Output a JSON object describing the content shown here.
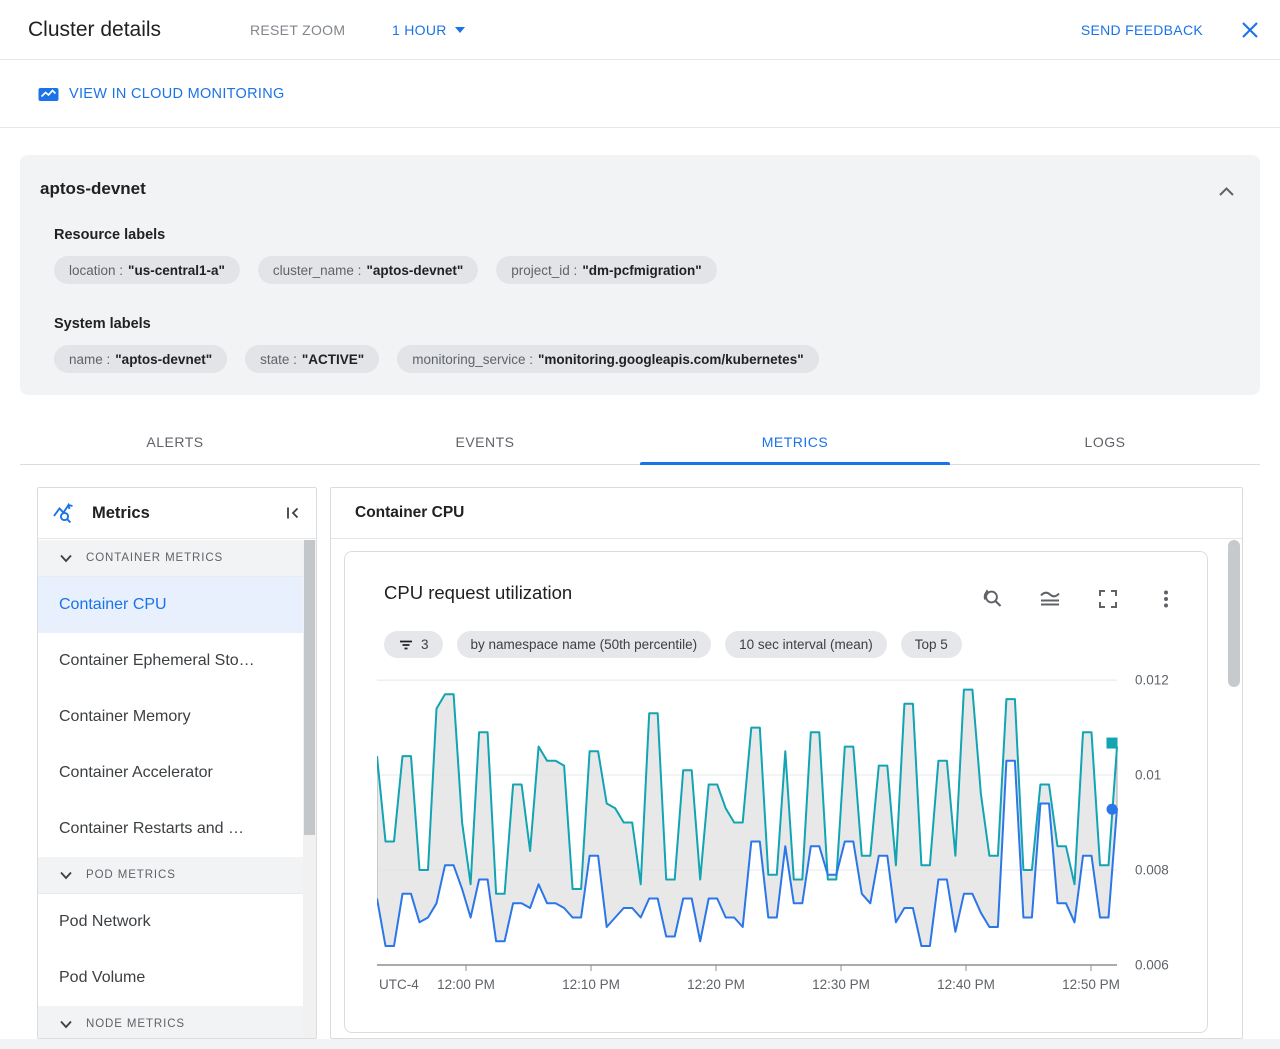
{
  "header": {
    "title": "Cluster details",
    "reset_zoom": "RESET ZOOM",
    "time_range": "1 HOUR",
    "send_feedback": "SEND FEEDBACK"
  },
  "toolbar": {
    "view_in_monitoring": "VIEW IN CLOUD MONITORING"
  },
  "cluster_info": {
    "name": "aptos-devnet",
    "resource_labels_title": "Resource labels",
    "resource_labels": [
      {
        "key": "location",
        "value": "\"us-central1-a\""
      },
      {
        "key": "cluster_name",
        "value": "\"aptos-devnet\""
      },
      {
        "key": "project_id",
        "value": "\"dm-pcfmigration\""
      }
    ],
    "system_labels_title": "System labels",
    "system_labels": [
      {
        "key": "name",
        "value": "\"aptos-devnet\""
      },
      {
        "key": "state",
        "value": "\"ACTIVE\""
      },
      {
        "key": "monitoring_service",
        "value": "\"monitoring.googleapis.com/kubernetes\""
      }
    ]
  },
  "tabs": [
    {
      "label": "ALERTS",
      "active": false
    },
    {
      "label": "EVENTS",
      "active": false
    },
    {
      "label": "METRICS",
      "active": true
    },
    {
      "label": "LOGS",
      "active": false
    }
  ],
  "sidebar": {
    "title": "Metrics",
    "sections": [
      {
        "header": "CONTAINER METRICS",
        "items": [
          {
            "label": "Container CPU",
            "selected": true
          },
          {
            "label": "Container Ephemeral Sto…",
            "selected": false
          },
          {
            "label": "Container Memory",
            "selected": false
          },
          {
            "label": "Container Accelerator",
            "selected": false
          },
          {
            "label": "Container Restarts and …",
            "selected": false
          }
        ]
      },
      {
        "header": "POD METRICS",
        "items": [
          {
            "label": "Pod Network",
            "selected": false
          },
          {
            "label": "Pod Volume",
            "selected": false
          }
        ]
      },
      {
        "header": "NODE METRICS",
        "items": []
      }
    ]
  },
  "main": {
    "panel_title": "Container CPU",
    "card": {
      "title": "CPU request utilization",
      "filter_chip_count": "3",
      "chips": [
        "by namespace name (50th percentile)",
        "10 sec interval (mean)",
        "Top 5"
      ]
    }
  },
  "chart_data": {
    "type": "line",
    "title": "CPU request utilization",
    "x_axis_label": "UTC-4",
    "x_tick_labels": [
      "12:00 PM",
      "12:10 PM",
      "12:20 PM",
      "12:30 PM",
      "12:40 PM",
      "12:50 PM"
    ],
    "y_ticks": [
      0.006,
      0.008,
      0.01,
      0.012
    ],
    "y_tick_labels": [
      "0.006",
      "0.008",
      "0.01",
      "0.012"
    ],
    "ylim": [
      0.006,
      0.01217
    ],
    "grid": "horizontal",
    "legend": "none",
    "band": {
      "between": [
        "max",
        "min"
      ],
      "fill": "#e4e4e4",
      "edge": "#aaaaaa"
    },
    "series": [
      {
        "name": "max",
        "color": "#12a4b2",
        "marker": "square",
        "values": [
          0.0104,
          0.0086,
          0.0086,
          0.0104,
          0.0104,
          0.008,
          0.008,
          0.0114,
          0.0117,
          0.0117,
          0.009,
          0.0077,
          0.0109,
          0.0109,
          0.0075,
          0.0075,
          0.0098,
          0.0098,
          0.0084,
          0.0106,
          0.0103,
          0.0103,
          0.0102,
          0.0076,
          0.0076,
          0.0105,
          0.0105,
          0.0094,
          0.0093,
          0.009,
          0.009,
          0.0077,
          0.0113,
          0.0113,
          0.0078,
          0.0078,
          0.0101,
          0.0101,
          0.0078,
          0.0098,
          0.0098,
          0.0093,
          0.009,
          0.009,
          0.011,
          0.011,
          0.0079,
          0.0079,
          0.0105,
          0.0078,
          0.0078,
          0.0109,
          0.0109,
          0.0078,
          0.0078,
          0.0106,
          0.0106,
          0.0083,
          0.0083,
          0.0102,
          0.0102,
          0.0081,
          0.0115,
          0.0115,
          0.0081,
          0.0081,
          0.0103,
          0.0103,
          0.0083,
          0.0118,
          0.0118,
          0.0096,
          0.0083,
          0.0083,
          0.0116,
          0.0116,
          0.008,
          0.008,
          0.0098,
          0.0098,
          0.0085,
          0.0085,
          0.0077,
          0.0109,
          0.0109,
          0.0081,
          0.0081,
          0.0106
        ]
      },
      {
        "name": "min",
        "color": "#2b76e8",
        "marker": "circle",
        "values": [
          0.0074,
          0.0064,
          0.0064,
          0.0075,
          0.0075,
          0.0069,
          0.007,
          0.0073,
          0.0081,
          0.0081,
          0.0076,
          0.007,
          0.0078,
          0.0078,
          0.0065,
          0.0065,
          0.0073,
          0.0073,
          0.0072,
          0.0077,
          0.0073,
          0.0073,
          0.0072,
          0.007,
          0.007,
          0.0083,
          0.0083,
          0.0068,
          0.007,
          0.0072,
          0.0072,
          0.007,
          0.0074,
          0.0074,
          0.0066,
          0.0066,
          0.0074,
          0.0074,
          0.0065,
          0.0074,
          0.0074,
          0.007,
          0.007,
          0.0068,
          0.0086,
          0.0086,
          0.007,
          0.007,
          0.0085,
          0.0073,
          0.0073,
          0.0085,
          0.0085,
          0.0079,
          0.0079,
          0.0086,
          0.0086,
          0.0075,
          0.0073,
          0.0083,
          0.0083,
          0.0069,
          0.0072,
          0.0072,
          0.0064,
          0.0064,
          0.0078,
          0.0078,
          0.0067,
          0.0075,
          0.0075,
          0.0071,
          0.0068,
          0.0068,
          0.0103,
          0.0103,
          0.007,
          0.007,
          0.0094,
          0.0094,
          0.0073,
          0.0073,
          0.0069,
          0.0083,
          0.0083,
          0.007,
          0.007,
          0.0093
        ]
      }
    ]
  },
  "icons": {
    "close": "close-icon",
    "chevron_down": "chevron-down-icon",
    "chevron_up": "chevron-up-icon",
    "monitoring_chart": "monitoring-chart-icon",
    "metrics": "metrics-search-icon",
    "collapse_panel": "collapse-panel-icon",
    "filter": "filter-list-icon",
    "zoom_reset": "zoom-reset-icon",
    "chart_style": "chart-style-icon",
    "fullscreen": "fullscreen-icon",
    "more": "kebab-menu-icon"
  },
  "colors": {
    "accent": "#1a73e8",
    "teal_series": "#12a4b2",
    "blue_series": "#2b76e8",
    "selected_bg": "#e8f0fe",
    "chip_bg": "#e2e4e7",
    "panel_border": "#dadce0",
    "section_bg": "#f1f3f4",
    "text_primary": "#202124",
    "text_secondary": "#5f6368"
  }
}
